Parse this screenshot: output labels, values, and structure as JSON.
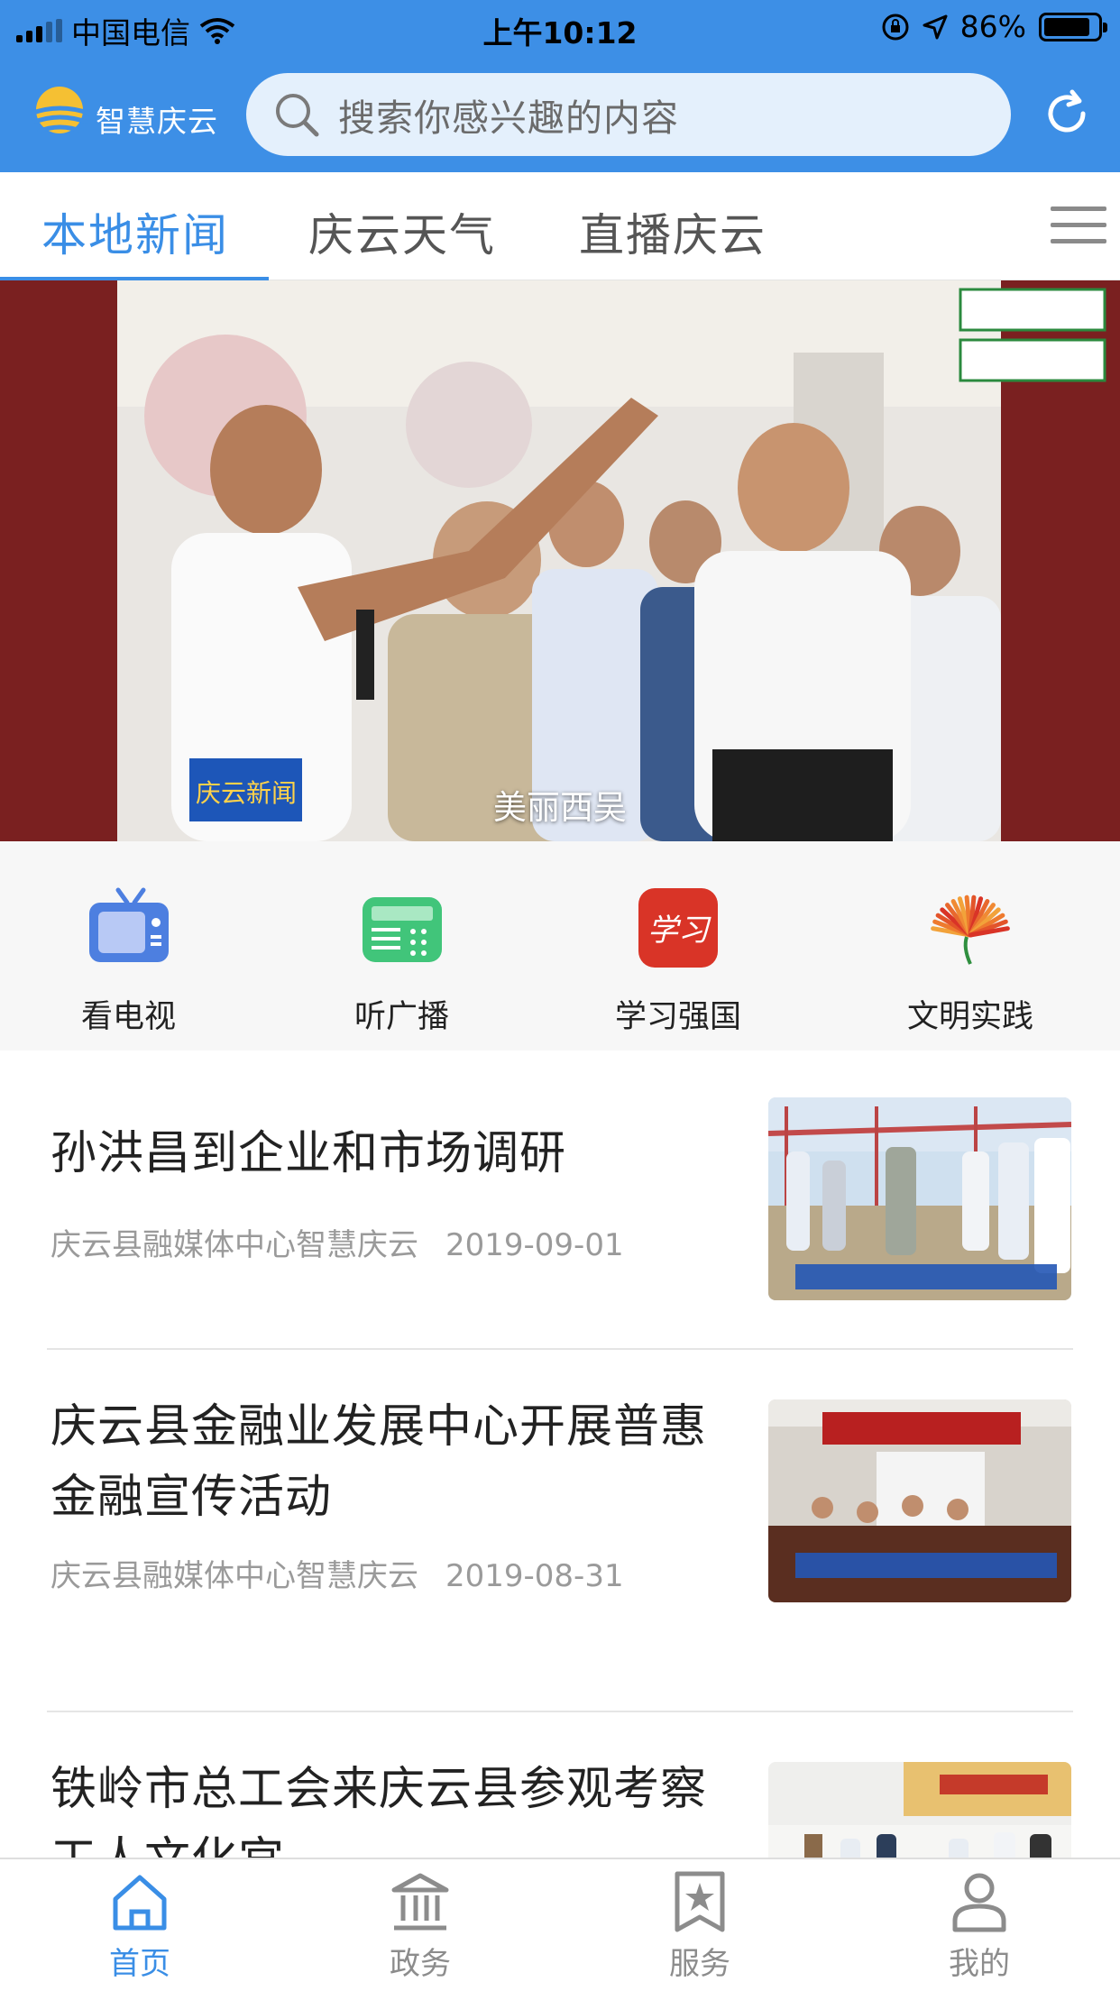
{
  "status_bar": {
    "carrier": "中国电信",
    "time": "上午10:12",
    "battery": "86%",
    "battery_level": 0.86
  },
  "header": {
    "logo_text": "智慧庆云",
    "search_placeholder": "搜索你感兴趣的内容",
    "icons": {
      "search": "search-icon",
      "refresh": "refresh-icon",
      "logo": "sun-logo-icon"
    }
  },
  "tabs": {
    "items": [
      {
        "label": "本地新闻",
        "active": true
      },
      {
        "label": "庆云天气",
        "active": false
      },
      {
        "label": "直播庆云",
        "active": false
      }
    ],
    "menu_icon": "menu-icon"
  },
  "banner": {
    "caption": "美丽西吴",
    "watermark": "庆云新闻"
  },
  "quick_entries": [
    {
      "label": "看电视",
      "icon": "tv-icon"
    },
    {
      "label": "听广播",
      "icon": "radio-icon"
    },
    {
      "label": "学习强国",
      "icon": "xuexi-icon"
    },
    {
      "label": "文明实践",
      "icon": "civilization-icon"
    }
  ],
  "news": [
    {
      "title": "孙洪昌到企业和市场调研",
      "source": "庆云县融媒体中心智慧庆云",
      "date": "2019-09-01"
    },
    {
      "title": "庆云县金融业发展中心开展普惠金融宣传活动",
      "source": "庆云县融媒体中心智慧庆云",
      "date": "2019-08-31"
    },
    {
      "title": "铁岭市总工会来庆云县参观考察工人文化宫",
      "source": "",
      "date": ""
    }
  ],
  "bottom_tabs": [
    {
      "label": "首页",
      "icon": "home-icon",
      "active": true
    },
    {
      "label": "政务",
      "icon": "government-icon",
      "active": false
    },
    {
      "label": "服务",
      "icon": "bookmark-star-icon",
      "active": false
    },
    {
      "label": "我的",
      "icon": "user-icon",
      "active": false
    }
  ],
  "colors": {
    "primary": "#3d8fe6",
    "active_text": "#3a8ee6",
    "text": "#222222",
    "meta": "#9a9a9a"
  }
}
